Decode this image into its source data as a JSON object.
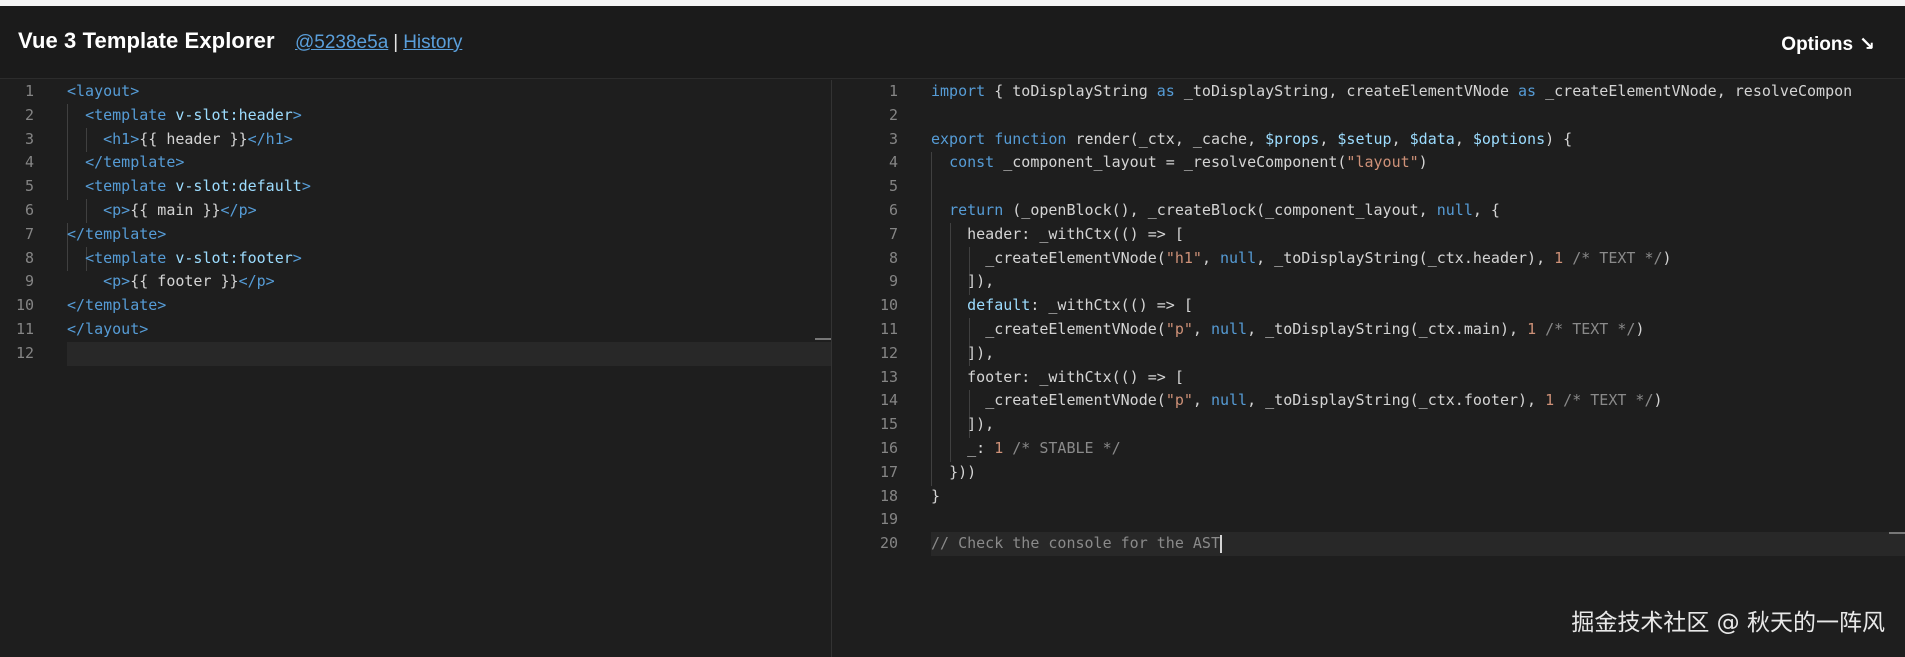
{
  "header": {
    "title": "Vue 3 Template Explorer",
    "commit_link": "@5238e5a",
    "separator": "|",
    "history_link": "History",
    "options_label": "Options",
    "options_arrow": "↘"
  },
  "template_pane": {
    "line_numbers": [
      "1",
      "2",
      "3",
      "4",
      "5",
      "6",
      "7",
      "8",
      "9",
      "10",
      "11",
      "12"
    ]
  },
  "output_pane": {
    "line_numbers": [
      "1",
      "2",
      "3",
      "4",
      "5",
      "6",
      "7",
      "8",
      "9",
      "10",
      "11",
      "12",
      "13",
      "14",
      "15",
      "16",
      "17",
      "18",
      "19",
      "20"
    ]
  },
  "watermark": "掘金技术社区 @ 秋天的一阵风",
  "colors": {
    "background": "#1e1e1e",
    "header_bg": "#1b1b1b",
    "link": "#5a9fdb",
    "keyword": "#569cd6",
    "string": "#ce9178",
    "number": "#b5cea8",
    "comment": "#6a9955"
  }
}
